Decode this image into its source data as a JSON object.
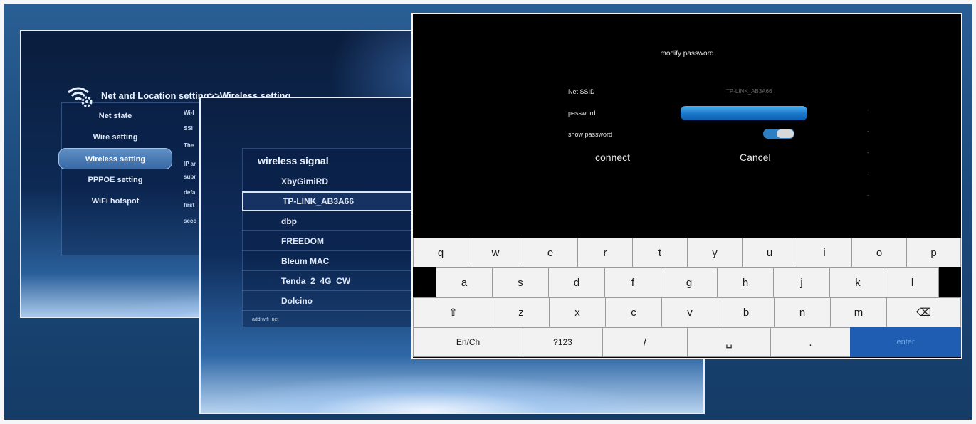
{
  "screen_settings": {
    "title": "Net and Location setting>>Wireless setting",
    "menu": [
      {
        "label": "Net state"
      },
      {
        "label": "Wire setting"
      },
      {
        "label": "Wireless setting",
        "active": true
      },
      {
        "label": "PPPOE setting"
      },
      {
        "label": "WiFi hotspot"
      }
    ],
    "content_fragments": [
      "Wi-I",
      "SSI",
      "The",
      "IP ar",
      "subr",
      "defa",
      "first",
      "seco"
    ]
  },
  "screen_wireless": {
    "heading": "wireless signal",
    "networks": [
      {
        "ssid": "XbyGimiRD"
      },
      {
        "ssid": "TP-LINK_AB3A66",
        "selected": true
      },
      {
        "ssid": "dbp"
      },
      {
        "ssid": "FREEDOM"
      },
      {
        "ssid": "Bleum MAC"
      },
      {
        "ssid": "Tenda_2_4G_CW"
      },
      {
        "ssid": "Dolcino"
      }
    ],
    "add_link": "add wifi_net"
  },
  "dialog": {
    "title": "modify password",
    "ssid_label": "Net SSID",
    "ssid_value": "TP-LINK_AB3A66",
    "password_label": "password",
    "password_value": "",
    "show_password_label": "show password",
    "show_password_on": true,
    "connect_label": "connect",
    "cancel_label": "Cancel"
  },
  "keyboard": {
    "row1": [
      "q",
      "w",
      "e",
      "r",
      "t",
      "y",
      "u",
      "i",
      "o",
      "p"
    ],
    "row2": [
      "a",
      "s",
      "d",
      "f",
      "g",
      "h",
      "j",
      "k",
      "l"
    ],
    "row3": [
      "⇧",
      "z",
      "x",
      "c",
      "v",
      "b",
      "n",
      "m",
      "⌫"
    ],
    "row4": [
      "En/Ch",
      "?123",
      "/",
      "␣",
      ".",
      "enter"
    ]
  },
  "colors": {
    "accent_blue": "#1e5db1",
    "field_blue": "#2a8ad8",
    "dialog_bg": "#000000",
    "key_bg": "#f2f2f2"
  }
}
